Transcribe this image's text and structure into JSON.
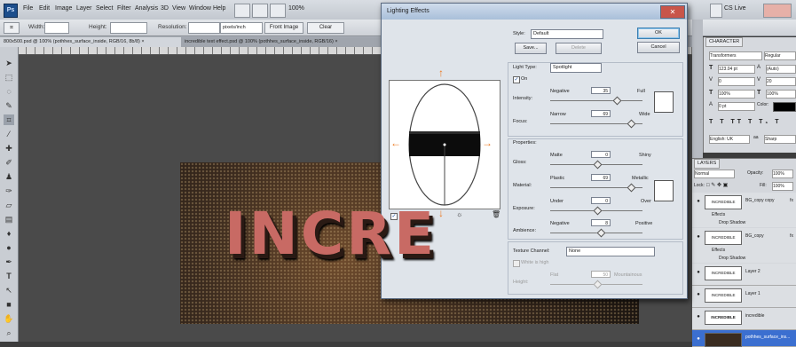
{
  "menubar": {
    "app_icon": "Ps",
    "items": [
      "File",
      "Edit",
      "Image",
      "Layer",
      "Select",
      "Filter",
      "Analysis",
      "3D",
      "View",
      "Window",
      "Help"
    ],
    "zoom": "100%",
    "essentials": "CS Live"
  },
  "options_bar": {
    "width_label": "Width:",
    "height_label": "Height:",
    "resolution_label": "Resolution:",
    "resolution_unit": "pixels/inch",
    "front_image": "Front Image",
    "clear": "Clear"
  },
  "doc_tabs": [
    "800x500.psd @ 100% (pothhes_surface_inside, RGB/16, 8b/8) ×",
    "incredible text effect.psd @ 100% (pothhes_surface_inside, RGB/16) ×"
  ],
  "artwork": {
    "text": "INCRE"
  },
  "dialog": {
    "title": "Lighting Effects",
    "style_label": "Style:",
    "style_value": "Default",
    "save": "Save...",
    "delete": "Delete",
    "ok": "OK",
    "cancel": "Cancel",
    "light_type_label": "Light Type:",
    "light_type_value": "Spotlight",
    "on_label": "On",
    "intensity_label": "Intensity:",
    "intensity_min": "Negative",
    "intensity_max": "Full",
    "intensity_value": "35",
    "focus_label": "Focus:",
    "focus_min": "Narrow",
    "focus_max": "Wide",
    "focus_value": "69",
    "properties_label": "Properties:",
    "gloss_label": "Gloss:",
    "gloss_min": "Matte",
    "gloss_max": "Shiny",
    "gloss_value": "0",
    "material_label": "Material:",
    "material_min": "Plastic",
    "material_max": "Metallic",
    "material_value": "69",
    "exposure_label": "Exposure:",
    "exposure_min": "Under",
    "exposure_max": "Over",
    "exposure_value": "0",
    "ambience_label": "Ambience:",
    "ambience_min": "Negative",
    "ambience_max": "Positive",
    "ambience_value": "8",
    "texture_label": "Texture Channel:",
    "texture_value": "None",
    "white_high_label": "White is high",
    "height_label": "Height:",
    "height_min": "Flat",
    "height_max": "Mountainous",
    "height_value": "50",
    "preview_label": "Preview"
  },
  "character_panel": {
    "tab": "CHARACTER",
    "font_family": "Transformers",
    "font_style": "Regular",
    "font_size": "123.04 pt",
    "leading": "(Auto)",
    "kerning": "0",
    "tracking": "20",
    "vscale": "100%",
    "hscale": "100%",
    "baseline": "0 pt",
    "color_label": "Color:",
    "language": "English: UK",
    "aa": "Sharp"
  },
  "layers_panel": {
    "tab": "LAYERS",
    "blend": "Normal",
    "opacity_label": "Opacity:",
    "opacity": "100%",
    "lock_label": "Lock:",
    "fill_label": "Fill:",
    "fill": "100%",
    "layers": [
      {
        "thumb": "INCREDIBLE",
        "name": "BG_copy copy",
        "fx": true,
        "effects": [
          "Effects",
          "Drop Shadow"
        ]
      },
      {
        "thumb": "INCREDIBLE",
        "name": "BG_copy",
        "fx": true,
        "effects": [
          "Effects",
          "Drop Shadow"
        ]
      },
      {
        "thumb": "INCREDIBLE",
        "name": "Layer 2",
        "fx": false,
        "effects": []
      },
      {
        "thumb": "INCREDIBLE",
        "name": "Layer 1",
        "fx": false,
        "effects": []
      },
      {
        "thumb": "INCREDIBLE",
        "name": "incredible",
        "fx": false,
        "effects": []
      },
      {
        "thumb": "",
        "name": "pothhes_surface_ins...",
        "fx": false,
        "effects": [],
        "selected": true
      }
    ]
  },
  "colors": {
    "accent_arrow": "#ec7a21",
    "selected_layer": "#3b6fd0"
  }
}
